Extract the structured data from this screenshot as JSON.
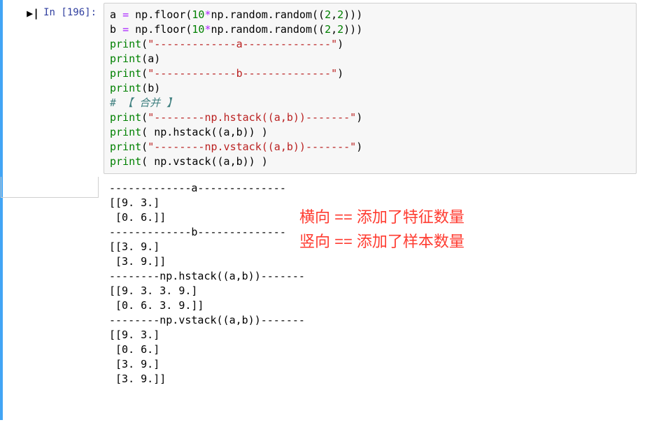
{
  "prompt": {
    "run_icon": "▶|",
    "label": "In ",
    "exec_count": "[196]:"
  },
  "code": {
    "l1_a": "a ",
    "l1_eq": "= ",
    "l1_np1": "np",
    "l1_dot1": ".",
    "l1_floor": "floor",
    "l1_open1": "(",
    "l1_ten": "10",
    "l1_star": "*",
    "l1_np2": "np",
    "l1_dot2": ".",
    "l1_rand1": "random",
    "l1_dot3": ".",
    "l1_rand2": "random",
    "l1_open2": "((",
    "l1_two1": "2",
    "l1_comma": ",",
    "l1_two2": "2",
    "l1_close": ")))",
    "l2_b": "b ",
    "l2_eq": "= ",
    "l2_np1": "np",
    "l2_dot1": ".",
    "l2_floor": "floor",
    "l2_open1": "(",
    "l2_ten": "10",
    "l2_star": "*",
    "l2_np2": "np",
    "l2_dot2": ".",
    "l2_rand1": "random",
    "l2_dot3": ".",
    "l2_rand2": "random",
    "l2_open2": "((",
    "l2_two1": "2",
    "l2_comma": ",",
    "l2_two2": "2",
    "l2_close": ")))",
    "l3_print": "print",
    "l3_open": "(",
    "l3_str": "\"-------------a--------------\"",
    "l3_close": ")",
    "l4_print": "print",
    "l4_open": "(",
    "l4_arg": "a",
    "l4_close": ")",
    "l5_print": "print",
    "l5_open": "(",
    "l5_str": "\"-------------b--------------\"",
    "l5_close": ")",
    "l6_print": "print",
    "l6_open": "(",
    "l6_arg": "b",
    "l6_close": ")",
    "l7_comment": "# 【 合并 】",
    "l8_print": "print",
    "l8_open": "(",
    "l8_str": "\"--------np.hstack((a,b))-------\"",
    "l8_close": ")",
    "l9_print": "print",
    "l9_open": "( ",
    "l9_np": "np",
    "l9_dot": ".",
    "l9_fn": "hstack",
    "l9_args": "((a,b)) ",
    "l9_close": ")",
    "l10_print": "print",
    "l10_open": "(",
    "l10_str": "\"--------np.vstack((a,b))-------\"",
    "l10_close": ")",
    "l11_print": "print",
    "l11_open": "( ",
    "l11_np": "np",
    "l11_dot": ".",
    "l11_fn": "vstack",
    "l11_args": "((a,b)) ",
    "l11_close": ")"
  },
  "output": {
    "line1": "-------------a--------------",
    "line2": "[[9. 3.]",
    "line3": " [0. 6.]]",
    "line4": "-------------b--------------",
    "line5": "[[3. 9.]",
    "line6": " [3. 9.]]",
    "line7": "--------np.hstack((a,b))-------",
    "line8": "[[9. 3. 3. 9.]",
    "line9": " [0. 6. 3. 9.]]",
    "line10": "--------np.vstack((a,b))-------",
    "line11": "[[9. 3.]",
    "line12": " [0. 6.]",
    "line13": " [3. 9.]",
    "line14": " [3. 9.]]"
  },
  "annotation": {
    "line1": "横向 == 添加了特征数量",
    "line2": "竖向 == 添加了样本数量"
  }
}
